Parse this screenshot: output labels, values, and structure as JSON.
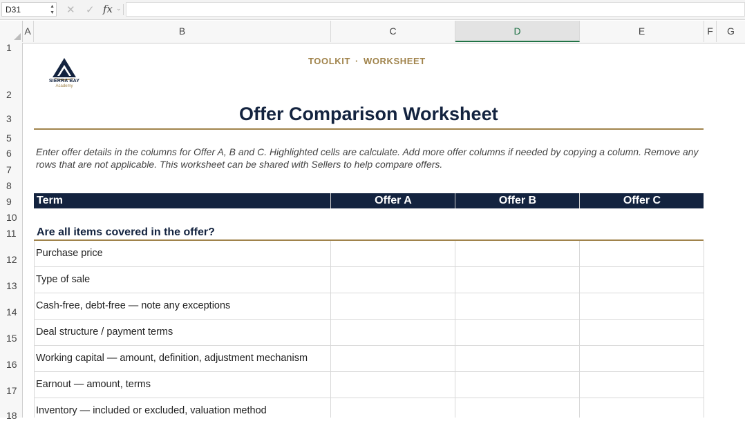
{
  "formula_bar": {
    "name_box": "D31",
    "cancel_icon": "close-icon",
    "enter_icon": "checkmark-icon",
    "fx_label": "fx",
    "formula": ""
  },
  "columns": [
    "A",
    "B",
    "C",
    "D",
    "E",
    "F",
    "G"
  ],
  "selected_column": "D",
  "rows": [
    "1",
    "2",
    "3",
    "5",
    "6",
    "7",
    "8",
    "9",
    "10",
    "11",
    "12",
    "13",
    "14",
    "15",
    "16",
    "17",
    "18"
  ],
  "logo": {
    "name": "SIERRA BAY",
    "sub": "Academy",
    "colors": {
      "navy": "#13233f",
      "gold": "#a0834b"
    }
  },
  "sheet": {
    "kicker_left": "TOOLKIT",
    "kicker_sep": "·",
    "kicker_right": "WORKSHEET",
    "title": "Offer Comparison Worksheet",
    "intro": "Enter offer details in the columns for Offer A, B and C. Highlighted cells are calculate. Add more offer columns if needed by copying a column. Remove any rows that are not applicable. This worksheet can be shared with Sellers to help compare offers.",
    "table_headers": {
      "term": "Term",
      "offer_a": "Offer A",
      "offer_b": "Offer B",
      "offer_c": "Offer C"
    },
    "section_title": "Are all items covered in the offer?",
    "terms": [
      "Purchase price",
      "Type of sale",
      "Cash-free, debt-free — note any exceptions",
      "Deal structure / payment terms",
      "Working capital — amount, definition, adjustment mechanism",
      "Earnout — amount, terms",
      "Inventory — included or excluded, valuation method"
    ]
  },
  "colors": {
    "header_navy": "#13233f",
    "accent_gold": "#a0834b",
    "excel_green": "#217346"
  }
}
